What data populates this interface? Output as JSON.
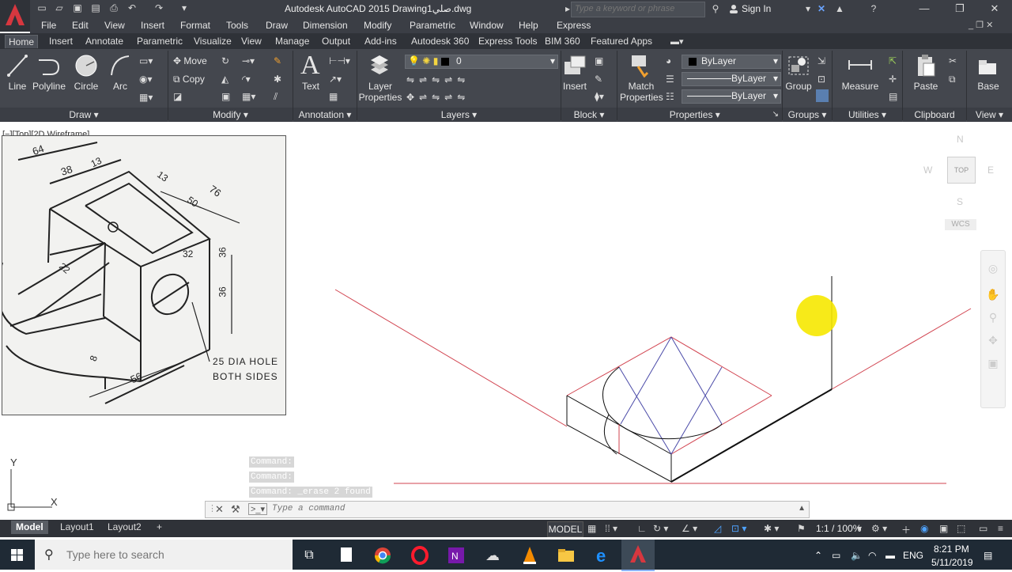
{
  "titlebar": {
    "title": "Autodesk AutoCAD 2015   Drawingصلي1.dwg",
    "search_placeholder": "Type a keyword or phrase",
    "sign_in": "Sign In"
  },
  "menu": [
    "File",
    "Edit",
    "View",
    "Insert",
    "Format",
    "Tools",
    "Draw",
    "Dimension",
    "Modify",
    "Parametric",
    "Window",
    "Help",
    "Express"
  ],
  "tabs": [
    "Home",
    "Insert",
    "Annotate",
    "Parametric",
    "Visualize",
    "View",
    "Manage",
    "Output",
    "Add-ins",
    "Autodesk 360",
    "Express Tools",
    "BIM 360",
    "Featured Apps"
  ],
  "active_tab": "Home",
  "ribbon": {
    "draw": {
      "line": "Line",
      "polyline": "Polyline",
      "circle": "Circle",
      "arc": "Arc",
      "footer": "Draw"
    },
    "modify": {
      "move": "Move",
      "copy": "Copy",
      "footer": "Modify"
    },
    "annotation": {
      "text": "Text",
      "footer": "Annotation"
    },
    "layers": {
      "layer_properties_1": "Layer",
      "layer_properties_2": "Properties",
      "current_layer": "0",
      "footer": "Layers"
    },
    "block": {
      "insert": "Insert",
      "footer": "Block"
    },
    "properties": {
      "match_1": "Match",
      "match_2": "Properties",
      "color": "ByLayer",
      "linetype": "ByLayer",
      "lineweight": "ByLayer",
      "footer": "Properties"
    },
    "groups": {
      "group": "Group",
      "footer": "Groups"
    },
    "utilities": {
      "measure": "Measure",
      "footer": "Utilities"
    },
    "clipboard": {
      "paste": "Paste",
      "footer": "Clipboard"
    },
    "view": {
      "base": "Base",
      "footer": "View"
    }
  },
  "viewport": {
    "label": "[−][Top][2D Wireframe]"
  },
  "ref_drawing": {
    "dims": [
      "64",
      "38",
      "13",
      "13",
      "76",
      "50",
      "32",
      "36",
      "36",
      "22",
      "8",
      "56"
    ],
    "note_1": "25 DIA HOLE",
    "note_2": "BOTH SIDES"
  },
  "viewcube": {
    "n": "N",
    "s": "S",
    "e": "E",
    "w": "W",
    "top": "TOP",
    "wcs": "WCS"
  },
  "ucs": {
    "x": "X",
    "y": "Y"
  },
  "command": {
    "history": [
      "Command:",
      "Command:",
      "Command: _erase 2 found"
    ],
    "placeholder": "Type a command"
  },
  "layouts": [
    "Model",
    "Layout1",
    "Layout2"
  ],
  "status": {
    "model": "MODEL",
    "scale": "1:1 / 100%"
  },
  "taskbar": {
    "search_placeholder": "Type here to search",
    "lang": "ENG",
    "time": "8:21 PM",
    "date": "5/11/2019"
  },
  "colors": {
    "accent_red": "#d7373f",
    "drawing_red": "#d1434f",
    "drawing_blue": "#4a4aa8",
    "highlight": "#f6e800"
  }
}
